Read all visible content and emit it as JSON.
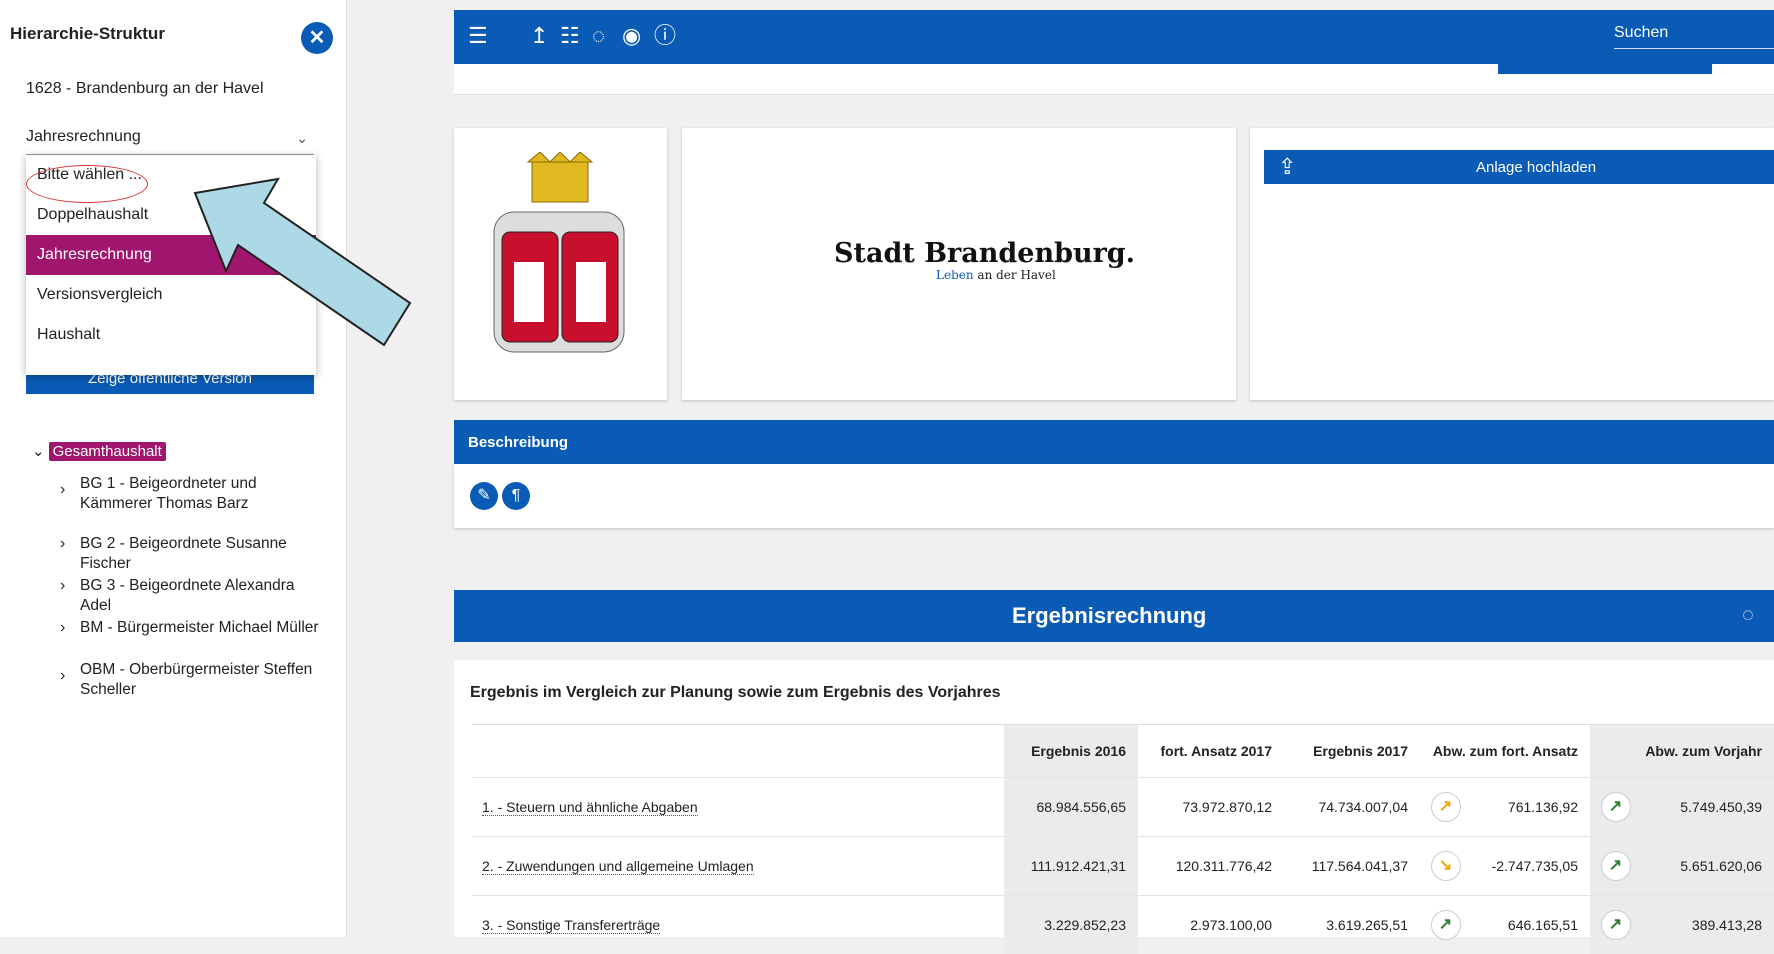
{
  "sidebar": {
    "title": "Hierarchie-Struktur",
    "org": "1628 - Brandenburg an der Havel",
    "select_value": "Jahresrechnung",
    "dropdown_options": [
      "Bitte wählen ...",
      "Doppelhaushalt",
      "Jahresrechnung",
      "Versionsvergleich",
      "Haushalt"
    ],
    "public_button": "Zeige öffentliche Version",
    "tree_root": "Gesamthaushalt",
    "tree_items": [
      "BG 1 - Beigeordneter und Kämmerer Thomas Barz",
      "BG 2 - Beigeordnete Susanne Fischer",
      "BG 3 - Beigeordnete Alexandra Adel",
      "BM - Bürgermeister Michael Müller",
      "OBM - Oberbürgermeister Steffen Scheller"
    ]
  },
  "toolbar": {
    "search_placeholder": "Suchen"
  },
  "upload": {
    "label": "Anlage hochladen"
  },
  "brand": {
    "name": "Stadt Brandenburg.",
    "sub_blue": "Leben",
    "sub_rest": " an der Havel"
  },
  "description": {
    "label": "Beschreibung"
  },
  "ergebnis": {
    "title": "Ergebnisrechnung",
    "subtitle": "Ergebnis im Vergleich zur Planung sowie zum Ergebnis des Vorjahres",
    "columns": [
      "Ergebnis 2016",
      "fort. Ansatz 2017",
      "Ergebnis 2017",
      "Abw. zum fort. Ansatz",
      "Abw. zum Vorjahr"
    ],
    "rows": [
      {
        "label": "1. - Steuern und ähnliche Abgaben",
        "e2016": "68.984.556,65",
        "ansatz": "73.972.870,12",
        "e2017": "74.734.007,04",
        "abw_ansatz": "761.136,92",
        "abw_ansatz_arrow": "↗",
        "abw_vj": "5.749.450,39",
        "abw_vj_arrow": "↗"
      },
      {
        "label": "2. - Zuwendungen und allgemeine Umlagen",
        "e2016": "111.912.421,31",
        "ansatz": "120.311.776,42",
        "e2017": "117.564.041,37",
        "abw_ansatz": "-2.747.735,05",
        "abw_ansatz_arrow": "↘",
        "abw_vj": "5.651.620,06",
        "abw_vj_arrow": "↗"
      },
      {
        "label": "3. - Sonstige Transfererträge",
        "e2016": "3.229.852,23",
        "ansatz": "2.973.100,00",
        "e2017": "3.619.265,51",
        "abw_ansatz": "646.165,51",
        "abw_ansatz_arrow": "↗",
        "abw_vj": "389.413,28",
        "abw_vj_arrow": "↗"
      }
    ]
  }
}
